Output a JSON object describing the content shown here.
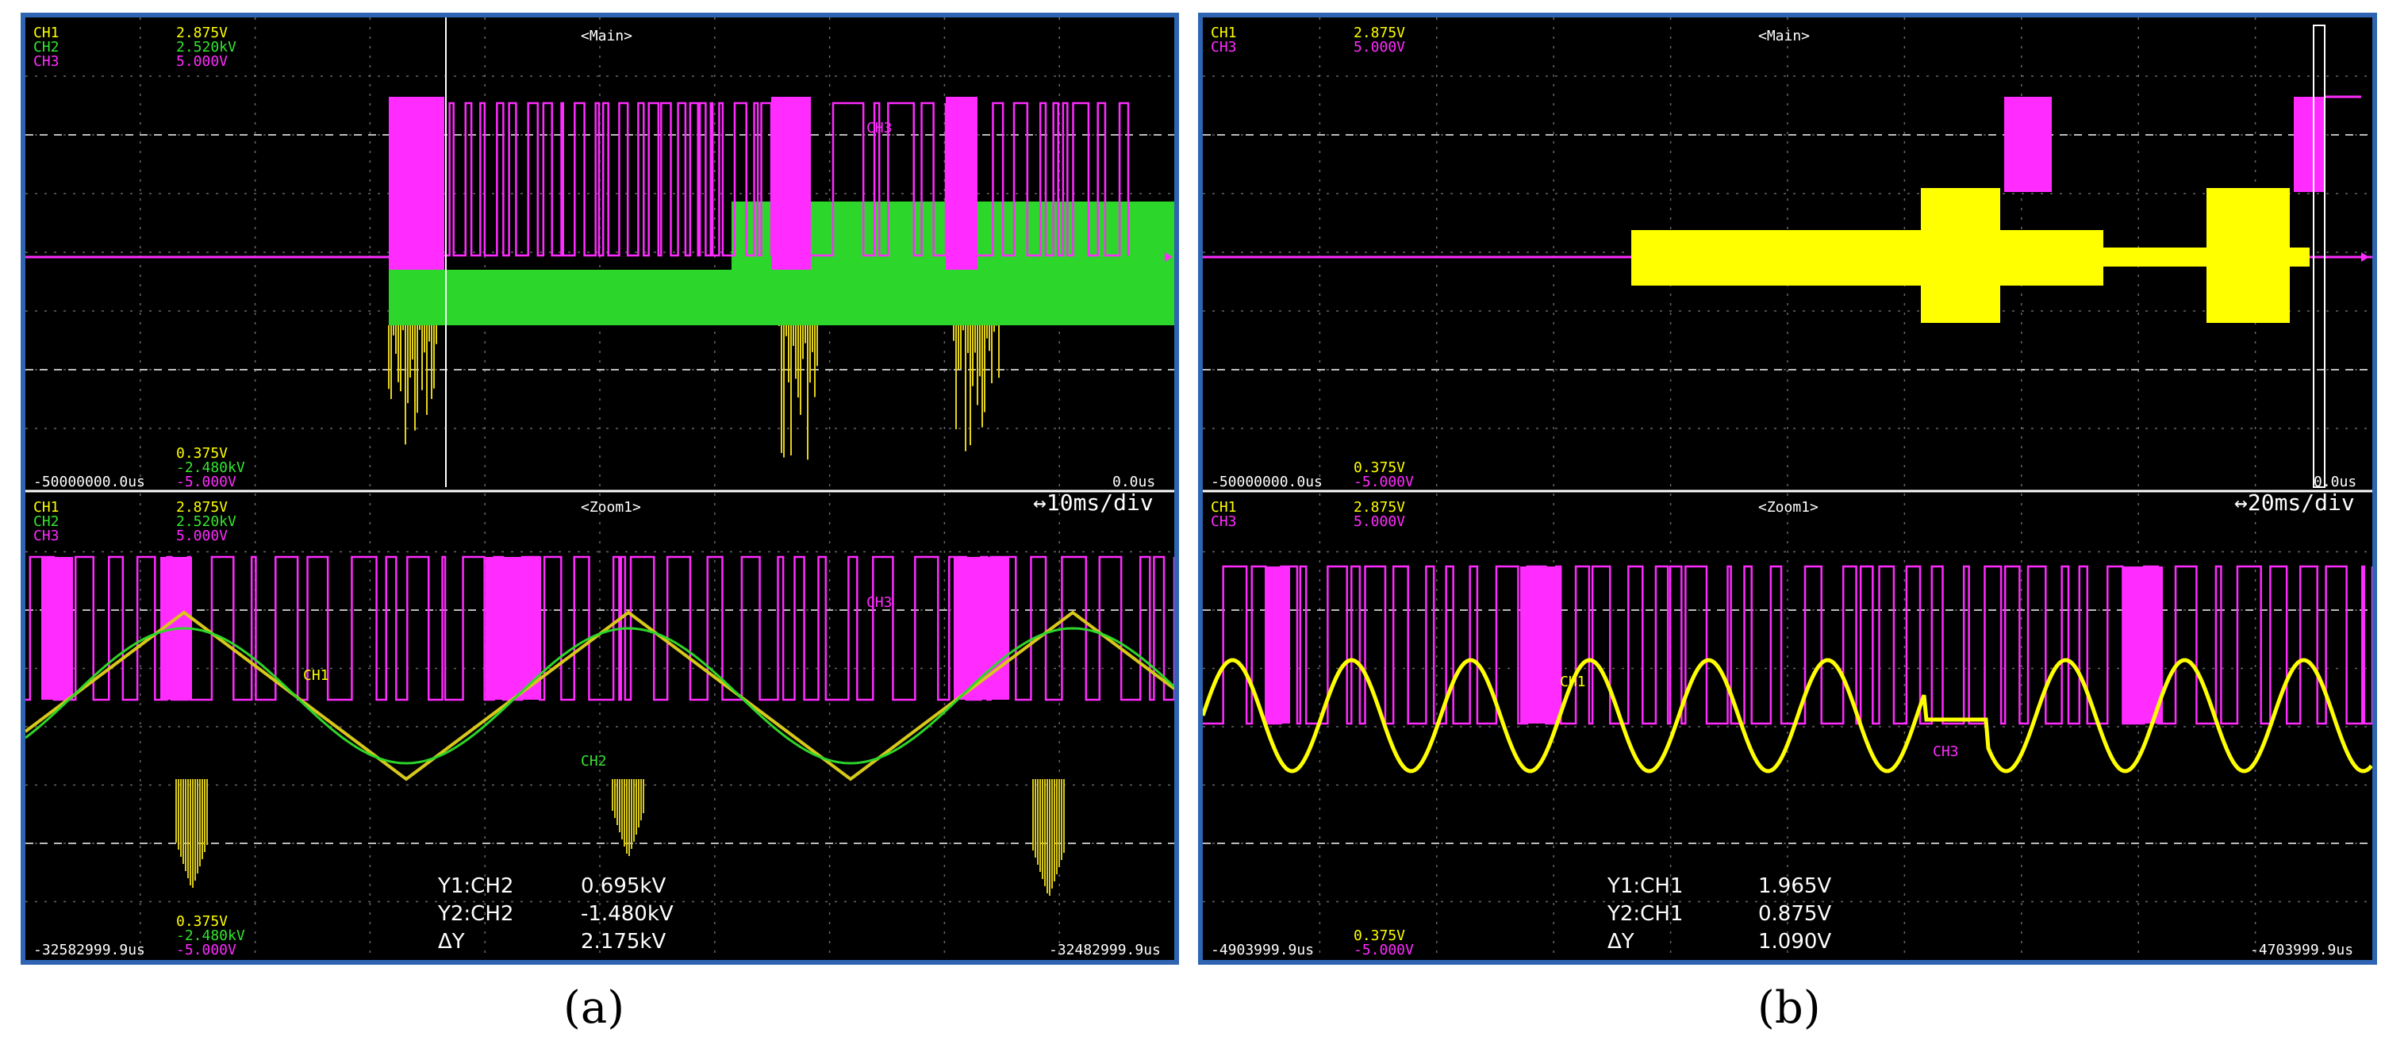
{
  "panels": [
    {
      "id": "a",
      "main": {
        "channels": [
          {
            "name": "CH1",
            "value": "2.875V",
            "color": "#ffff00"
          },
          {
            "name": "CH2",
            "value": "2.520kV",
            "color": "#33e62e"
          },
          {
            "name": "CH3",
            "value": "5.000V",
            "color": "#ff2bff"
          }
        ],
        "title": "<Main>",
        "bottom_values": [
          "0.375V",
          "-2.480kV",
          "-5.000V"
        ],
        "time_left": "-50000000.0us",
        "time_right": "0.0us",
        "trace_label": "CH3"
      },
      "zoom": {
        "channels": [
          {
            "name": "CH1",
            "value": "2.875V"
          },
          {
            "name": "CH2",
            "value": "2.520kV"
          },
          {
            "name": "CH3",
            "value": "5.000V"
          }
        ],
        "title": "<Zoom1>",
        "timebase": "↔10ms/div",
        "bottom_values": [
          "0.375V",
          "-2.480kV",
          "-5.000V"
        ],
        "time_left": "-32582999.9us",
        "time_right": "-32482999.9us",
        "trace_labels": {
          "ch1": "CH1",
          "ch2": "CH2",
          "ch3": "CH3"
        },
        "measurements": [
          {
            "label": "Y1:CH2",
            "value": "0.695kV"
          },
          {
            "label": "Y2:CH2",
            "value": "-1.480kV"
          },
          {
            "label": "ΔY",
            "value": "2.175kV"
          }
        ]
      },
      "caption": "(a)"
    },
    {
      "id": "b",
      "main": {
        "channels": [
          {
            "name": "CH1",
            "value": "2.875V",
            "color": "#ffff00"
          },
          {
            "name": "CH3",
            "value": "5.000V",
            "color": "#ff2bff"
          }
        ],
        "title": "<Main>",
        "bottom_values": [
          "0.375V",
          "-5.000V"
        ],
        "time_left": "-50000000.0us",
        "time_right": "0.0us"
      },
      "zoom": {
        "channels": [
          {
            "name": "CH1",
            "value": "2.875V"
          },
          {
            "name": "CH3",
            "value": "5.000V"
          }
        ],
        "title": "<Zoom1>",
        "timebase": "↔20ms/div",
        "bottom_values": [
          "0.375V",
          "-5.000V"
        ],
        "time_left": "-4903999.9us",
        "time_right": "-4703999.9us",
        "trace_labels": {
          "ch1": "CH1",
          "ch3": "CH3"
        },
        "measurements": [
          {
            "label": "Y1:CH1",
            "value": "1.965V"
          },
          {
            "label": "Y2:CH1",
            "value": "0.875V"
          },
          {
            "label": "ΔY",
            "value": "1.090V"
          }
        ]
      },
      "caption": "(b)"
    }
  ]
}
